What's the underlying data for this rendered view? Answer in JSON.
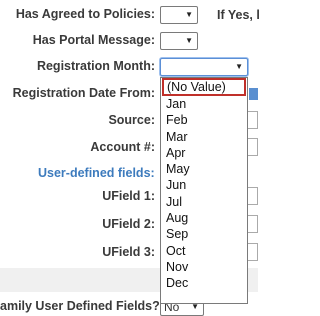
{
  "form": {
    "has_agreed": {
      "label": "Has Agreed to Policies:",
      "trailing": "If Yes, l"
    },
    "has_portal": {
      "label": "Has Portal Message:"
    },
    "reg_month": {
      "label": "Registration Month:",
      "value": ""
    },
    "reg_date_from": {
      "label": "Registration Date From:"
    },
    "source": {
      "label": "Source:"
    },
    "account": {
      "label": "Account #:"
    },
    "user_defined": {
      "label": "User-defined fields:"
    },
    "ufield1": {
      "label": "UField 1:"
    },
    "ufield2": {
      "label": "UField 2:"
    },
    "ufield3": {
      "label": "UField 3:"
    },
    "family_udf": {
      "label": "amily User Defined Fields?",
      "value": "No"
    }
  },
  "month_dropdown": {
    "options": [
      "(No Value)",
      "Jan",
      "Feb",
      "Mar",
      "Apr",
      "May",
      "Jun",
      "Jul",
      "Aug",
      "Sep",
      "Oct",
      "Nov",
      "Dec"
    ],
    "highlighted": "(No Value)"
  },
  "colors": {
    "label_blue": "#3d7bbd",
    "highlight_border": "#c0302a",
    "focus_border": "#5b8fd6"
  },
  "icons": {
    "select_arrow": "chevron-down-icon",
    "calendar": "calendar-icon"
  }
}
